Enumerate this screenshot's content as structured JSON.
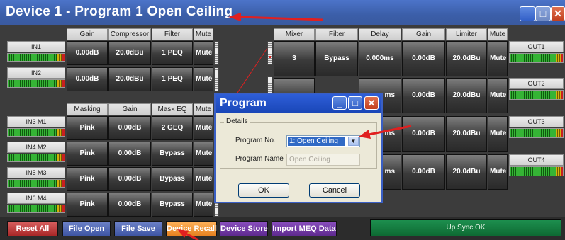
{
  "window": {
    "title": "Device 1  -  Program 1  Open Ceiling",
    "min_label": "_",
    "max_label": "□",
    "close_label": "✕"
  },
  "inputs_header": {
    "gain": "Gain",
    "compressor": "Compressor",
    "filter": "Filter",
    "mute": "Mute"
  },
  "input_rows": [
    {
      "label": "IN1",
      "gain": "0.00dB",
      "compressor": "20.0dBu",
      "filter": "1 PEQ",
      "mute": "Mute"
    },
    {
      "label": "IN2",
      "gain": "0.00dB",
      "compressor": "20.0dBu",
      "filter": "1 PEQ",
      "mute": "Mute"
    }
  ],
  "masking_header": {
    "masking": "Masking",
    "gain": "Gain",
    "mask_eq": "Mask EQ",
    "mute": "Mute"
  },
  "masking_rows": [
    {
      "label": "IN3 M1",
      "masking": "Pink",
      "gain": "0.00dB",
      "eq": "2 GEQ",
      "mute": "Mute"
    },
    {
      "label": "IN4 M2",
      "masking": "Pink",
      "gain": "0.00dB",
      "eq": "Bypass",
      "mute": "Mute"
    },
    {
      "label": "IN5 M3",
      "masking": "Pink",
      "gain": "0.00dB",
      "eq": "Bypass",
      "mute": "Mute"
    },
    {
      "label": "IN6 M4",
      "masking": "Pink",
      "gain": "0.00dB",
      "eq": "Bypass",
      "mute": "Mute"
    }
  ],
  "outputs_header": {
    "mixer": "Mixer",
    "filter": "Filter",
    "delay": "Delay",
    "gain": "Gain",
    "limiter": "Limiter",
    "mute": "Mute"
  },
  "output_rows": [
    {
      "label": "OUT1",
      "mixer": "3",
      "filter": "Bypass",
      "delay": "0.000ms",
      "gain": "0.00dB",
      "limiter": "20.0dBu",
      "mute": "Mute"
    },
    {
      "label": "OUT2",
      "delay": "ms",
      "gain": "0.00dB",
      "limiter": "20.0dBu",
      "mute": "Mute"
    },
    {
      "label": "OUT3",
      "delay": "ms",
      "gain": "0.00dB",
      "limiter": "20.0dBu",
      "mute": "Mute"
    },
    {
      "label": "OUT4",
      "delay": "ms",
      "gain": "0.00dB",
      "limiter": "20.0dBu",
      "mute": "Mute"
    }
  ],
  "toolbar": {
    "reset_all": "Reset All",
    "file_open": "File Open",
    "file_save": "File Save",
    "device_recall": "Device Recall",
    "device_store": "Device Store",
    "import_meq": "Import MEQ Data",
    "sync_status": "Up Sync OK"
  },
  "dialog": {
    "title": "Program",
    "group_label": "Details",
    "program_no_label": "Program No.",
    "program_no_value": "1: Open Ceiling",
    "program_name_label": "Program Name",
    "program_name_value": "Open Ceiling",
    "ok_label": "OK",
    "cancel_label": "Cancel",
    "arrow_glyph": "▼"
  },
  "colors": {
    "title_bar": "#3b5ea8",
    "sync_bar": "#0e6a33",
    "device_recall": "#e58120",
    "annotation_arrow": "#e02020"
  }
}
